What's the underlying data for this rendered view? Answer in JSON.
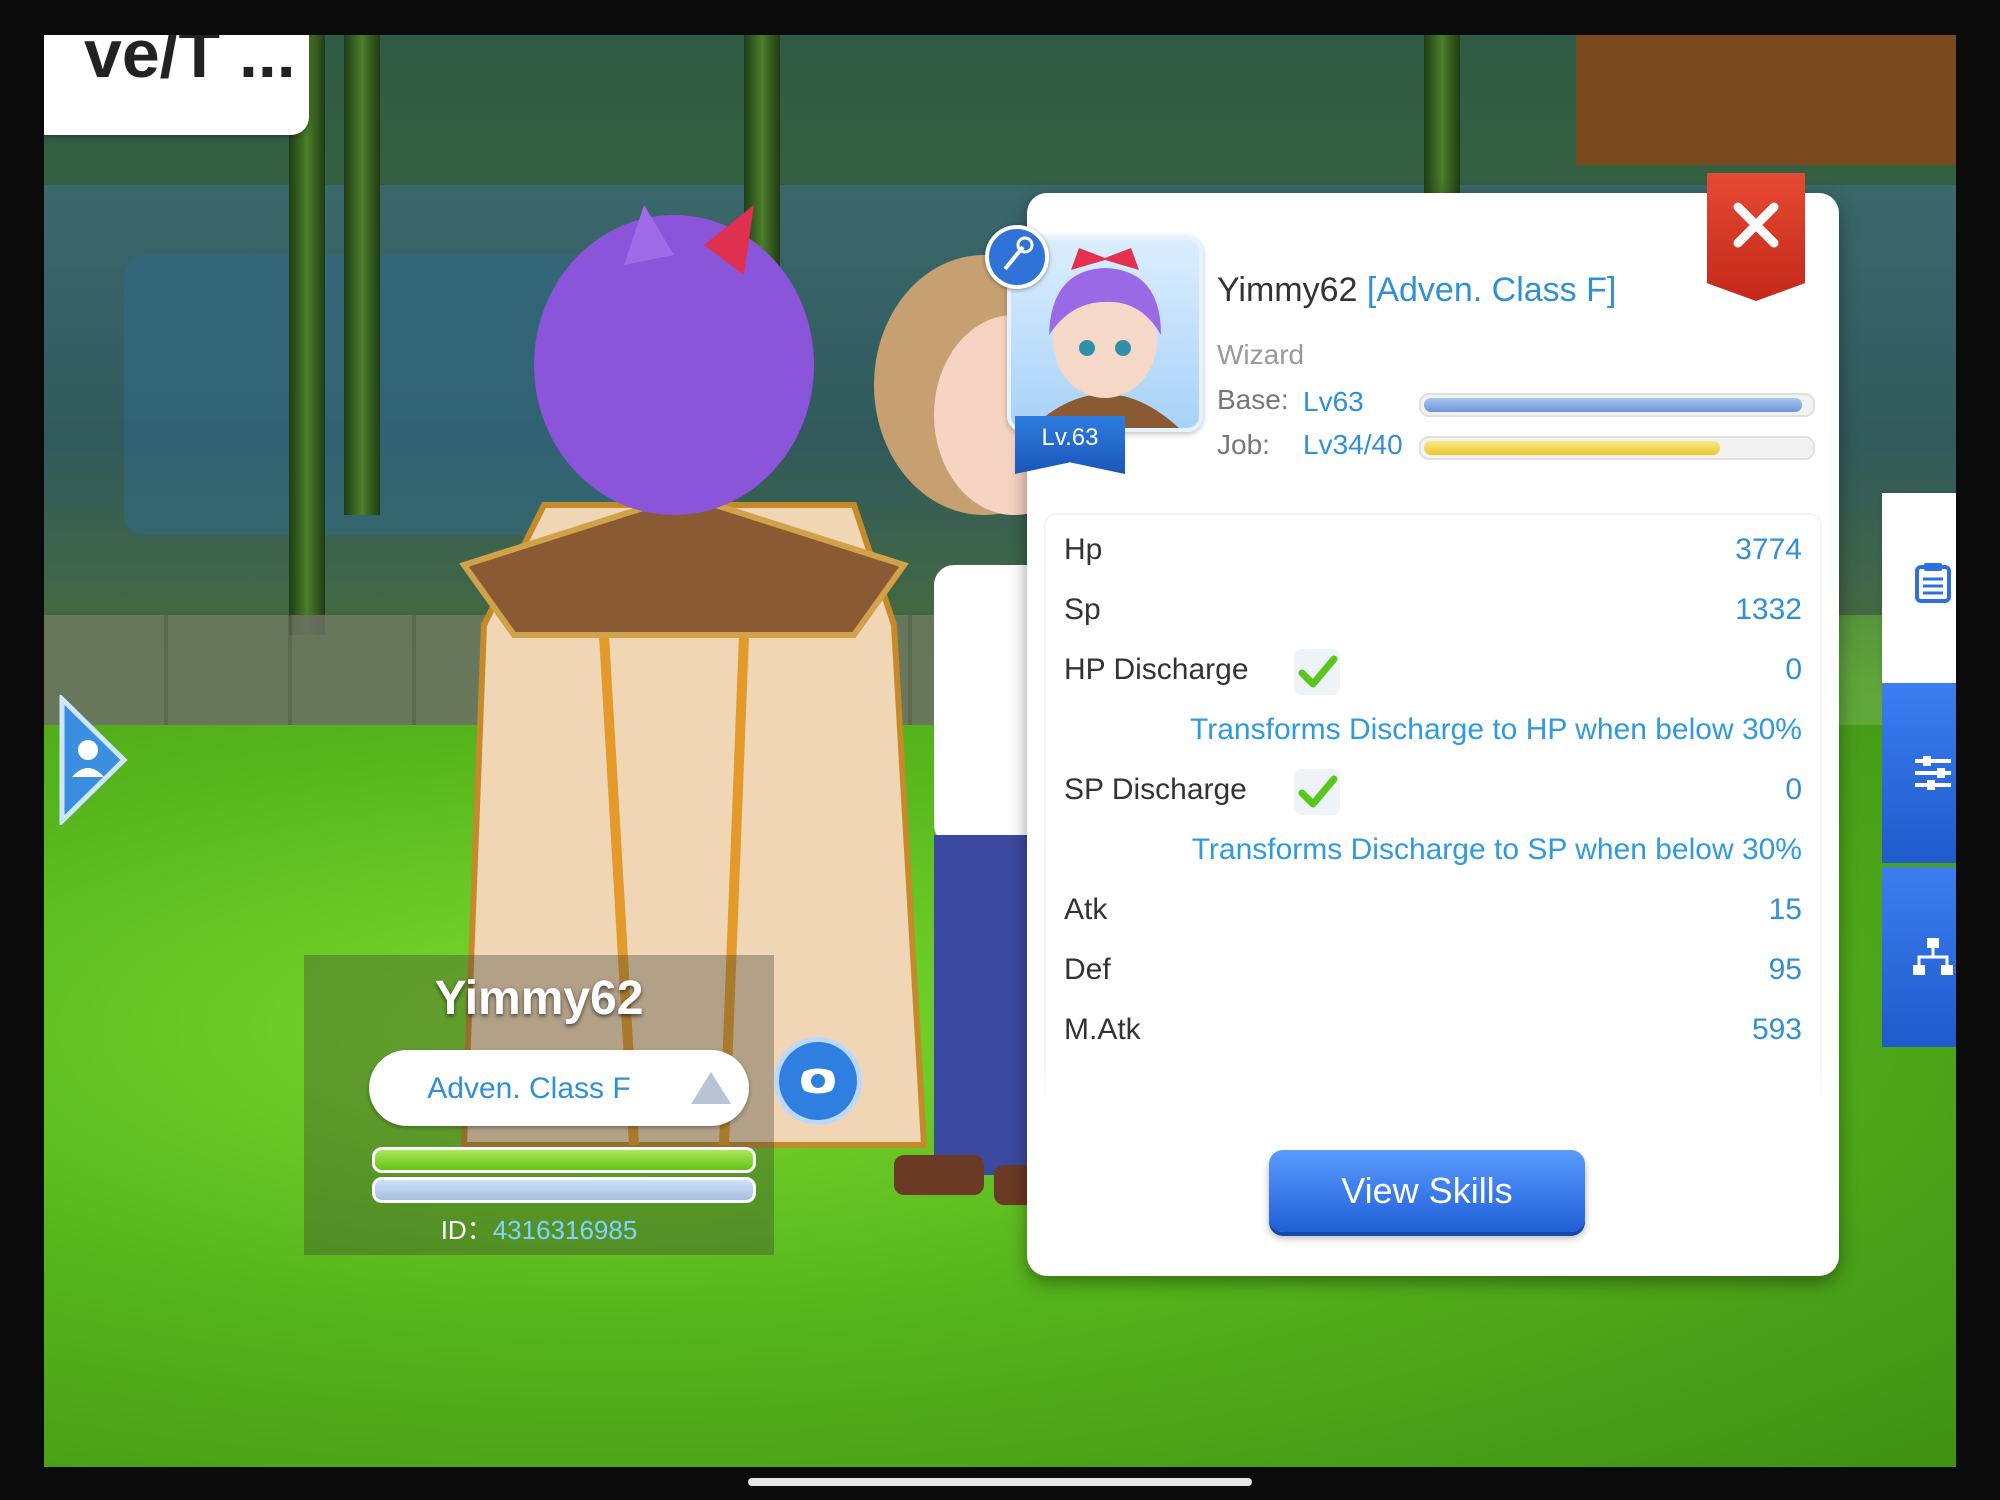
{
  "top_bubble": {
    "text": "ve/T ..."
  },
  "nameplate": {
    "name": "Yimmy62",
    "class_label": "Adven. Class F",
    "id_label": "ID：",
    "id_value": "4316316985",
    "hp_fraction": 1.0,
    "sp_fraction": 1.0
  },
  "profile": {
    "name": "Yimmy62",
    "class_tag": "[Adven. Class F]",
    "job": "Wizard",
    "level_badge": "Lv.63",
    "base_label": "Base:",
    "base_value": "Lv63",
    "base_progress": 0.98,
    "job_label": "Job:",
    "job_value": "Lv34/40",
    "job_progress": 0.77
  },
  "stats": [
    {
      "label": "Hp",
      "value": "3774"
    },
    {
      "label": "Sp",
      "value": "1332"
    },
    {
      "label": "HP Discharge",
      "value": "0",
      "checked": true,
      "note": "Transforms Discharge to HP when below 30%"
    },
    {
      "label": "SP Discharge",
      "value": "0",
      "checked": true,
      "note": "Transforms Discharge to SP when below 30%"
    },
    {
      "label": "Atk",
      "value": "15"
    },
    {
      "label": "Def",
      "value": "95"
    },
    {
      "label": "M.Atk",
      "value": "593"
    }
  ],
  "buttons": {
    "view_skills": "View Skills"
  },
  "side_tabs": [
    {
      "icon": "clipboard-icon",
      "active": true
    },
    {
      "icon": "sliders-icon",
      "active": false
    },
    {
      "icon": "hierarchy-icon",
      "active": false
    }
  ],
  "colors": {
    "accent_blue": "#2f8fd8",
    "close_red": "#d8321f",
    "button_blue": "#2f6fe0",
    "hp_green": "#7ed321",
    "job_yellow": "#f0d23a"
  }
}
